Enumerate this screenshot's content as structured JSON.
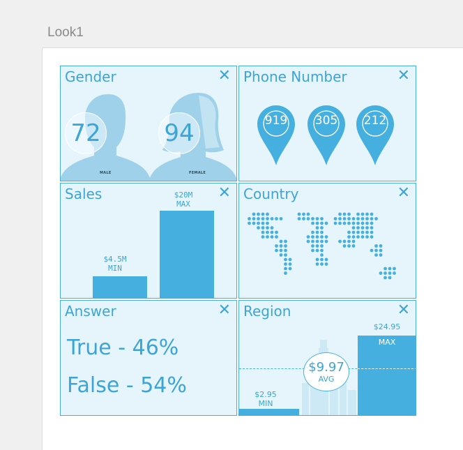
{
  "frame": {
    "title": "Look1"
  },
  "colors": {
    "accent": "#45b0e0",
    "card_bg": "#e6f5fc",
    "silhouette": "#9fd2ea"
  },
  "gender": {
    "title": "Gender",
    "male_value": "72",
    "female_value": "94",
    "male_label": "MALE",
    "female_label": "FEMALE"
  },
  "phone": {
    "title": "Phone Number",
    "pins": [
      "919",
      "305",
      "212"
    ]
  },
  "sales": {
    "title": "Sales",
    "min_value": "$4.5M",
    "min_label": "MIN",
    "max_value": "$20M",
    "max_label": "MAX"
  },
  "country": {
    "title": "Country"
  },
  "answer": {
    "title": "Answer",
    "true_text": "True - 46%",
    "false_text": "False - 54%"
  },
  "region": {
    "title": "Region",
    "min_value": "$2.95",
    "min_label": "MIN",
    "max_value": "$24.95",
    "max_label": "MAX",
    "avg_value": "$9.97",
    "avg_label": "AVG"
  },
  "icons": {
    "close": "close-icon",
    "pin": "map-pin-icon"
  },
  "close_glyph": "✕"
}
